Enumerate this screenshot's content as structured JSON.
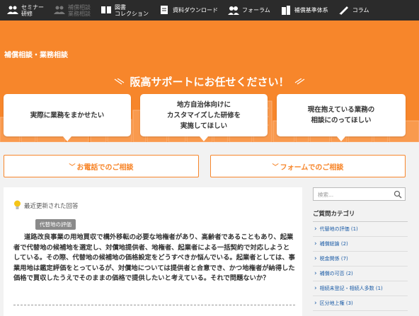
{
  "nav": {
    "items": [
      {
        "line1": "セミナー",
        "line2": "研修",
        "icon": "seminar-icon",
        "dim": false
      },
      {
        "line1": "補償相談",
        "line2": "業務相談",
        "icon": "consult-icon",
        "dim": true
      },
      {
        "line1": "図書",
        "line2": "コレクション",
        "icon": "book-icon",
        "dim": false
      },
      {
        "line1": "資料ダウンロード",
        "line2": "",
        "icon": "document-icon",
        "dim": false
      },
      {
        "line1": "フォーラム",
        "line2": "",
        "icon": "forum-icon",
        "dim": false
      },
      {
        "line1": "補償基準体系",
        "line2": "",
        "icon": "building-icon",
        "dim": false
      },
      {
        "line1": "コラム",
        "line2": "",
        "icon": "pen-icon",
        "dim": false
      }
    ]
  },
  "hero": {
    "title": "補償相談・業務相談",
    "subtitle": "阪高サポートにお任せください！",
    "bubbles": [
      {
        "text": "実際に業務をまかせたい"
      },
      {
        "text": "地方自治体向けに\nカスタマイズした研修を\n実施してほしい"
      },
      {
        "text": "現在抱えている業務の\n相談にのってほしい"
      }
    ]
  },
  "cta": {
    "phone": "お電話でのご相談",
    "form": "フォームでのご相談"
  },
  "main": {
    "latest_label": "最近更新された回答",
    "tag": "代替地の評価",
    "question": "道路改良事業の用地買収で構外移転の必要な地権者があり、高齢者であることもあり、起業者で代替地の候補地を選定し、対償地提供者、地権者、起業者による一括契約で対応しようとしている。その際、代替地の候補地の価格設定をどうすべきか悩んでいる。起業者としては、事業用地は鑑定評価をとっているが、対償地については提供者と合意でき、かつ地権者が納得した価格で買収したうえでそのままの価格で提供したいと考えている。それで問題ないか？"
  },
  "sidebar": {
    "search_placeholder": "検索...",
    "category_title": "ご質問カテゴリ",
    "categories": [
      "代替地の評価 (1)",
      "補償総論 (2)",
      "税金関係 (7)",
      "補償の可否 (2)",
      "相続未登記・相続人多数 (1)",
      "区分地上権 (3)"
    ]
  },
  "colors": {
    "accent": "#f7862b",
    "nav_bg": "#2b2b2b",
    "link": "#1a5ba6"
  }
}
